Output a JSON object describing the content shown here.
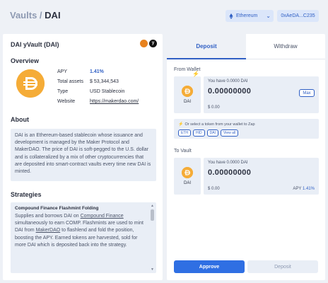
{
  "header": {
    "breadcrumb_root": "Vaults",
    "breadcrumb_sep": "/",
    "breadcrumb_current": "DAI",
    "network": "Ethereum",
    "wallet": "0xAeDA...C235"
  },
  "vault": {
    "title": "DAI yVault (DAI)",
    "overview_heading": "Overview",
    "apy_label": "APY",
    "apy_value": "1.41%",
    "total_assets_label": "Total assets",
    "total_assets_value": "$ 53,344,543",
    "type_label": "Type",
    "type_value": "USD Stablecoin",
    "website_label": "Website",
    "website_value": "https://makerdao.com/",
    "about_heading": "About",
    "about_text": "DAI is an Ethereum-based stablecoin whose issuance and development is managed by the Maker Protocol and MakerDAO. The price of DAI is soft-pegged to the U.S. dollar and is collateralized by a mix of other cryptocurrencies that are deposited into smart-contract vaults every time new DAI is minted.",
    "strategies_heading": "Strategies",
    "strategy_name": "Compound Finance Flashmint Folding",
    "strategy_desc_1": "Supplies and borrows DAI on ",
    "strategy_link_1": "Compound Finance",
    "strategy_desc_2": " simultaneously to earn COMP. Flashmints are used to mint DAI from ",
    "strategy_link_2": "MakerDAO",
    "strategy_desc_3": " to flashlend and fold the position, boosting the APY. Earned tokens are harvested, sold for more DAI which is deposited back into the strategy."
  },
  "panel": {
    "tab_deposit": "Deposit",
    "tab_withdraw": "Withdraw",
    "from_wallet_label": "From Wallet",
    "from_token": "DAI",
    "from_balance": "You have 0.0000 DAI",
    "from_amount": "0.00000000",
    "from_usd": "$ 0.00",
    "max_label": "Max",
    "zap_note": "Or select a token from your wallet to Zap",
    "zap_tokens": [
      "ETH",
      "HID",
      "DAI",
      "View all"
    ],
    "to_vault_label": "To Vault",
    "to_token": "DAI",
    "to_balance": "You have 0.0000 DAI",
    "to_amount": "0.00000000",
    "to_usd": "$ 0.00",
    "to_apy_label": "APY",
    "to_apy_value": "1.41%",
    "approve_label": "Approve",
    "deposit_label": "Deposit"
  },
  "colors": {
    "accent": "#2f6fe3",
    "dai": "#f5ac37",
    "panel_bg": "#e9eef6"
  },
  "icons": [
    "ethereum-icon",
    "chevron-down-icon",
    "metamask-icon",
    "yfi-icon",
    "dai-icon",
    "bolt-icon"
  ]
}
